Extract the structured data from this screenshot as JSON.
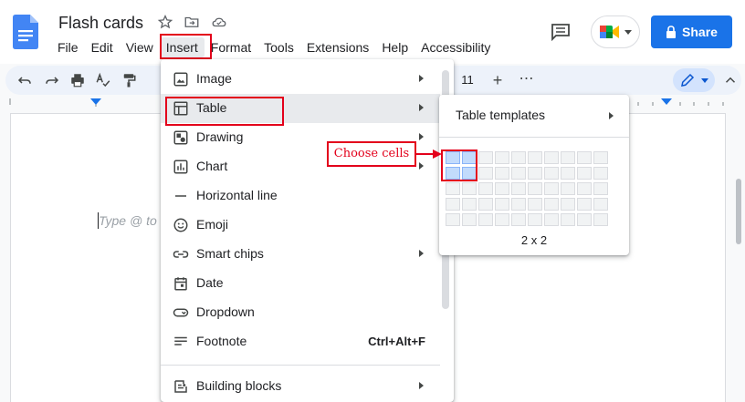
{
  "document": {
    "title": "Flash cards",
    "placeholder": "Type @ to"
  },
  "menubar": {
    "items": [
      "File",
      "Edit",
      "View",
      "Insert",
      "Format",
      "Tools",
      "Extensions",
      "Help",
      "Accessibility"
    ],
    "active": "Insert"
  },
  "header": {
    "share_label": "Share"
  },
  "toolbar": {
    "font_size": "11",
    "plus_label": "+",
    "more_label": "⋯"
  },
  "insert_menu": {
    "items": [
      {
        "label": "Image",
        "icon": "image-icon",
        "submenu": true
      },
      {
        "label": "Table",
        "icon": "table-icon",
        "submenu": true,
        "highlighted": true
      },
      {
        "label": "Drawing",
        "icon": "drawing-icon",
        "submenu": true
      },
      {
        "label": "Chart",
        "icon": "chart-icon",
        "submenu": true
      },
      {
        "label": "Horizontal line",
        "icon": "horizontal-line-icon",
        "submenu": false
      },
      {
        "label": "Emoji",
        "icon": "emoji-icon",
        "submenu": false
      },
      {
        "label": "Smart chips",
        "icon": "smart-chips-icon",
        "submenu": true
      },
      {
        "label": "Date",
        "icon": "calendar-icon",
        "submenu": false
      },
      {
        "label": "Dropdown",
        "icon": "dropdown-icon",
        "submenu": false
      },
      {
        "label": "Footnote",
        "icon": "footnote-icon",
        "submenu": false,
        "shortcut": "Ctrl+Alt+F"
      },
      {
        "label": "Building blocks",
        "icon": "building-blocks-icon",
        "submenu": true
      }
    ]
  },
  "table_submenu": {
    "templates_label": "Table templates",
    "grid_columns": 10,
    "grid_rows": 5,
    "selected_columns": 2,
    "selected_rows": 2,
    "size_label": "2 x 2"
  },
  "annotation": {
    "callout_text": "Choose cells"
  },
  "colors": {
    "accent": "#1a73e8",
    "annotation": "#e3001b",
    "selected_cell": "#c2dbfc"
  }
}
